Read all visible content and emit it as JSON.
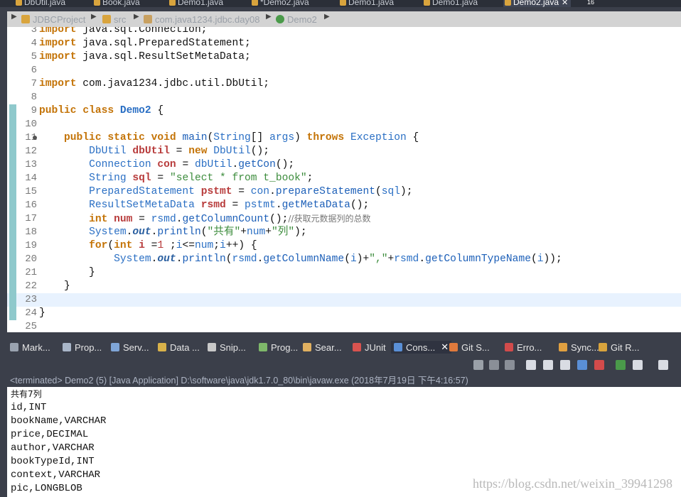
{
  "editor_tabs": [
    {
      "label": "DbUtil.java",
      "active": false
    },
    {
      "label": "Book.java",
      "active": false
    },
    {
      "label": "Demo1.java",
      "active": false
    },
    {
      "label": "*Demo2.java",
      "active": false
    },
    {
      "label": "Demo1.java",
      "active": false
    },
    {
      "label": "Demo1.java",
      "active": false
    },
    {
      "label": "Demo2.java",
      "active": true
    }
  ],
  "tab_overflow_count": "16",
  "breadcrumb": [
    "JDBCProject",
    "src",
    "com.java1234.jdbc.day08",
    "Demo2"
  ],
  "code": {
    "line_numbers": [
      "3",
      "4",
      "5",
      "6",
      "7",
      "8",
      "9",
      "10",
      "11",
      "12",
      "13",
      "14",
      "15",
      "16",
      "17",
      "18",
      "19",
      "20",
      "21",
      "22",
      "23",
      "24",
      "25"
    ],
    "tokens": [
      [
        [
          "kw",
          "import"
        ],
        [
          "plain",
          " java.sql.Connection;"
        ]
      ],
      [
        [
          "kw",
          "import"
        ],
        [
          "plain",
          " java.sql.PreparedStatement;"
        ]
      ],
      [
        [
          "kw",
          "import"
        ],
        [
          "plain",
          " java.sql.ResultSetMetaData;"
        ]
      ],
      [],
      [
        [
          "kw",
          "import"
        ],
        [
          "plain",
          " com.java1234.jdbc.util.DbUtil;"
        ]
      ],
      [],
      [
        [
          "kw",
          "public"
        ],
        [
          "plain",
          " "
        ],
        [
          "kw",
          "class"
        ],
        [
          "plain",
          " "
        ],
        [
          "cls",
          "Demo2"
        ],
        [
          "plain",
          " {"
        ]
      ],
      [],
      [
        [
          "plain",
          "    "
        ],
        [
          "kw",
          "public"
        ],
        [
          "plain",
          " "
        ],
        [
          "kw",
          "static"
        ],
        [
          "plain",
          " "
        ],
        [
          "kw",
          "void"
        ],
        [
          "plain",
          " "
        ],
        [
          "mth",
          "main"
        ],
        [
          "plain",
          "("
        ],
        [
          "type",
          "String"
        ],
        [
          "plain",
          "[] "
        ],
        [
          "type",
          "args"
        ],
        [
          "plain",
          ") "
        ],
        [
          "kw",
          "throws"
        ],
        [
          "plain",
          " "
        ],
        [
          "type",
          "Exception"
        ],
        [
          "plain",
          " {"
        ]
      ],
      [
        [
          "plain",
          "        "
        ],
        [
          "type",
          "DbUtil"
        ],
        [
          "plain",
          " "
        ],
        [
          "var",
          "dbUtil"
        ],
        [
          "plain",
          " = "
        ],
        [
          "kw",
          "new"
        ],
        [
          "plain",
          " "
        ],
        [
          "type",
          "DbUtil"
        ],
        [
          "plain",
          "();"
        ]
      ],
      [
        [
          "plain",
          "        "
        ],
        [
          "type",
          "Connection"
        ],
        [
          "plain",
          " "
        ],
        [
          "var",
          "con"
        ],
        [
          "plain",
          " = "
        ],
        [
          "type",
          "dbUtil"
        ],
        [
          "plain",
          "."
        ],
        [
          "mth",
          "getCon"
        ],
        [
          "plain",
          "();"
        ]
      ],
      [
        [
          "plain",
          "        "
        ],
        [
          "type",
          "String"
        ],
        [
          "plain",
          " "
        ],
        [
          "var",
          "sql"
        ],
        [
          "plain",
          " = "
        ],
        [
          "str",
          "\"select * from t_book\""
        ],
        [
          "plain",
          ";"
        ]
      ],
      [
        [
          "plain",
          "        "
        ],
        [
          "type",
          "PreparedStatement"
        ],
        [
          "plain",
          " "
        ],
        [
          "var",
          "pstmt"
        ],
        [
          "plain",
          " = "
        ],
        [
          "type",
          "con"
        ],
        [
          "plain",
          "."
        ],
        [
          "mth",
          "prepareStatement"
        ],
        [
          "plain",
          "("
        ],
        [
          "type",
          "sql"
        ],
        [
          "plain",
          ");"
        ]
      ],
      [
        [
          "plain",
          "        "
        ],
        [
          "type",
          "ResultSetMetaData"
        ],
        [
          "plain",
          " "
        ],
        [
          "var",
          "rsmd"
        ],
        [
          "plain",
          " = "
        ],
        [
          "type",
          "pstmt"
        ],
        [
          "plain",
          "."
        ],
        [
          "mth",
          "getMetaData"
        ],
        [
          "plain",
          "();"
        ]
      ],
      [
        [
          "plain",
          "        "
        ],
        [
          "kw",
          "int"
        ],
        [
          "plain",
          " "
        ],
        [
          "var",
          "num"
        ],
        [
          "plain",
          " = "
        ],
        [
          "type",
          "rsmd"
        ],
        [
          "plain",
          "."
        ],
        [
          "mth",
          "getColumnCount"
        ],
        [
          "plain",
          "();"
        ],
        [
          "cm",
          "//获取元数据列的总数"
        ]
      ],
      [
        [
          "plain",
          "        "
        ],
        [
          "type",
          "System"
        ],
        [
          "plain",
          "."
        ],
        [
          "fld",
          "out"
        ],
        [
          "plain",
          "."
        ],
        [
          "mth",
          "println"
        ],
        [
          "plain",
          "("
        ],
        [
          "str",
          "\"共有\""
        ],
        [
          "plain",
          "+"
        ],
        [
          "type",
          "num"
        ],
        [
          "plain",
          "+"
        ],
        [
          "str",
          "\"列\""
        ],
        [
          "plain",
          ");"
        ]
      ],
      [
        [
          "plain",
          "        "
        ],
        [
          "kw",
          "for"
        ],
        [
          "plain",
          "("
        ],
        [
          "kw",
          "int"
        ],
        [
          "plain",
          " "
        ],
        [
          "var",
          "i"
        ],
        [
          "plain",
          " ="
        ],
        [
          "num",
          "1"
        ],
        [
          "plain",
          " ;"
        ],
        [
          "type",
          "i"
        ],
        [
          "plain",
          "<="
        ],
        [
          "type",
          "num"
        ],
        [
          "plain",
          ";"
        ],
        [
          "type",
          "i"
        ],
        [
          "plain",
          "++) {"
        ]
      ],
      [
        [
          "plain",
          "            "
        ],
        [
          "type",
          "System"
        ],
        [
          "plain",
          "."
        ],
        [
          "fld",
          "out"
        ],
        [
          "plain",
          "."
        ],
        [
          "mth",
          "println"
        ],
        [
          "plain",
          "("
        ],
        [
          "type",
          "rsmd"
        ],
        [
          "plain",
          "."
        ],
        [
          "mth",
          "getColumnName"
        ],
        [
          "plain",
          "("
        ],
        [
          "type",
          "i"
        ],
        [
          "plain",
          ")+"
        ],
        [
          "str",
          "\",\""
        ],
        [
          "plain",
          "+"
        ],
        [
          "type",
          "rsmd"
        ],
        [
          "plain",
          "."
        ],
        [
          "mth",
          "getColumnTypeName"
        ],
        [
          "plain",
          "("
        ],
        [
          "type",
          "i"
        ],
        [
          "plain",
          "));"
        ]
      ],
      [
        [
          "plain",
          "        }"
        ]
      ],
      [
        [
          "plain",
          "    }"
        ]
      ],
      [],
      [
        [
          "plain",
          "}"
        ]
      ],
      []
    ],
    "changed_lines": [
      "9",
      "10",
      "11",
      "12",
      "13",
      "14",
      "15",
      "16",
      "17",
      "18",
      "19",
      "20",
      "21",
      "22",
      "23",
      "24"
    ],
    "current_line": "23",
    "fold_line": "11"
  },
  "view_tabs": [
    {
      "label": "Mark...",
      "icon": "markers-icon",
      "color": "#9aa3b0",
      "active": false
    },
    {
      "label": "Prop...",
      "icon": "properties-icon",
      "color": "#a9b6c8",
      "active": false
    },
    {
      "label": "Serv...",
      "icon": "servers-icon",
      "color": "#7fa6d8",
      "active": false
    },
    {
      "label": "Data ...",
      "icon": "data-source-icon",
      "color": "#d9b24a",
      "active": false
    },
    {
      "label": "Snip...",
      "icon": "snippets-icon",
      "color": "#c9c9c9",
      "active": false
    },
    {
      "label": "Prog...",
      "icon": "progress-icon",
      "color": "#7eb86a",
      "active": false
    },
    {
      "label": "Sear...",
      "icon": "search-icon",
      "color": "#e0b060",
      "active": false
    },
    {
      "label": "JUnit",
      "icon": "junit-icon",
      "color": "#d9534f",
      "active": false
    },
    {
      "label": "Cons...",
      "icon": "console-icon",
      "color": "#5a8fd6",
      "active": true
    },
    {
      "label": "Git S...",
      "icon": "git-staging-icon",
      "color": "#e07a3c",
      "active": false
    },
    {
      "label": "Erro...",
      "icon": "error-log-icon",
      "color": "#d24b4b",
      "active": false
    },
    {
      "label": "Sync...",
      "icon": "synchronize-icon",
      "color": "#e0a040",
      "active": false
    },
    {
      "label": "Git R...",
      "icon": "git-repositories-icon",
      "color": "#d9a43d",
      "active": false
    }
  ],
  "console_status": "<terminated> Demo2 (5) [Java Application] D:\\software\\java\\jdk1.7.0_80\\bin\\javaw.exe (2018年7月19日 下午4:16:57)",
  "console_output": [
    "共有7列",
    "id,INT",
    "bookName,VARCHAR",
    "price,DECIMAL",
    "author,VARCHAR",
    "bookTypeId,INT",
    "context,VARCHAR",
    "pic,LONGBLOB"
  ],
  "watermark": "https://blog.csdn.net/weixin_39941298"
}
